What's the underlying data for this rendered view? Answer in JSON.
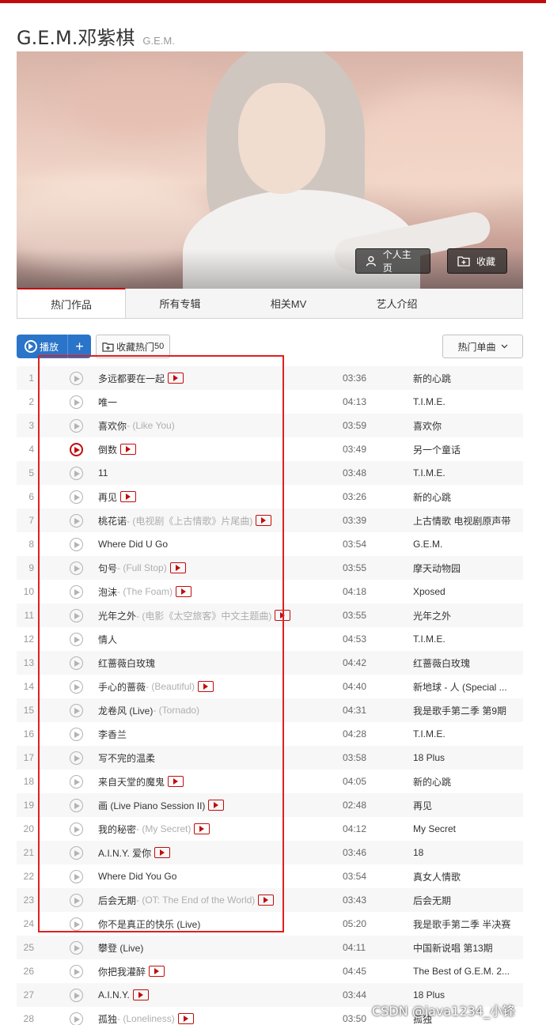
{
  "artist": {
    "name": "G.E.M.邓紫棋",
    "alias": "G.E.M."
  },
  "banner": {
    "home_label": "个人主页",
    "collect_label": "收藏"
  },
  "tabs": [
    {
      "label": "热门作品",
      "active": true
    },
    {
      "label": "所有专辑",
      "active": false
    },
    {
      "label": "相关MV",
      "active": false
    },
    {
      "label": "艺人介绍",
      "active": false
    }
  ],
  "actions": {
    "play_label": "播放",
    "add_label": "+",
    "fav_label": "收藏热门",
    "fav_count": "50",
    "hot_label": "热门单曲"
  },
  "songs": [
    {
      "index": "1",
      "title": "多远都要在一起",
      "alias": "",
      "mv": true,
      "duration": "03:36",
      "album": "新的心跳",
      "playing": false
    },
    {
      "index": "2",
      "title": "唯一",
      "alias": "",
      "mv": false,
      "duration": "04:13",
      "album": "T.I.M.E.",
      "playing": false
    },
    {
      "index": "3",
      "title": "喜欢你",
      "alias": " - (Like You)",
      "mv": false,
      "duration": "03:59",
      "album": "喜欢你",
      "playing": false
    },
    {
      "index": "4",
      "title": "倒数",
      "alias": "",
      "mv": true,
      "duration": "03:49",
      "album": "另一个童话",
      "playing": true
    },
    {
      "index": "5",
      "title": "11",
      "alias": "",
      "mv": false,
      "duration": "03:48",
      "album": "T.I.M.E.",
      "playing": false
    },
    {
      "index": "6",
      "title": "再见",
      "alias": "",
      "mv": true,
      "duration": "03:26",
      "album": "新的心跳",
      "playing": false
    },
    {
      "index": "7",
      "title": "桃花诺",
      "alias": " - (电视剧《上古情歌》片尾曲)",
      "mv": true,
      "duration": "03:39",
      "album": "上古情歌 电视剧原声带",
      "playing": false
    },
    {
      "index": "8",
      "title": "Where Did U Go",
      "alias": "",
      "mv": false,
      "duration": "03:54",
      "album": "G.E.M.",
      "playing": false
    },
    {
      "index": "9",
      "title": "句号",
      "alias": " - (Full Stop)",
      "mv": true,
      "duration": "03:55",
      "album": "摩天动物园",
      "playing": false
    },
    {
      "index": "10",
      "title": "泡沫",
      "alias": " - (The Foam)",
      "mv": true,
      "duration": "04:18",
      "album": "Xposed",
      "playing": false
    },
    {
      "index": "11",
      "title": "光年之外",
      "alias": " - (电影《太空旅客》中文主题曲)",
      "mv": true,
      "duration": "03:55",
      "album": "光年之外",
      "playing": false
    },
    {
      "index": "12",
      "title": "情人",
      "alias": "",
      "mv": false,
      "duration": "04:53",
      "album": "T.I.M.E.",
      "playing": false
    },
    {
      "index": "13",
      "title": "红蔷薇白玫瑰",
      "alias": "",
      "mv": false,
      "duration": "04:42",
      "album": "红蔷薇白玫瑰",
      "playing": false
    },
    {
      "index": "14",
      "title": "手心的蔷薇",
      "alias": " - (Beautiful)",
      "mv": true,
      "duration": "04:40",
      "album": "新地球 - 人 (Special ...",
      "playing": false
    },
    {
      "index": "15",
      "title": "龙卷风 (Live)",
      "alias": " - (Tornado)",
      "mv": false,
      "duration": "04:31",
      "album": "我是歌手第二季 第9期",
      "playing": false
    },
    {
      "index": "16",
      "title": "李香兰",
      "alias": "",
      "mv": false,
      "duration": "04:28",
      "album": "T.I.M.E.",
      "playing": false
    },
    {
      "index": "17",
      "title": "写不完的温柔",
      "alias": "",
      "mv": false,
      "duration": "03:58",
      "album": "18 Plus",
      "playing": false
    },
    {
      "index": "18",
      "title": "来自天堂的魔鬼",
      "alias": "",
      "mv": true,
      "duration": "04:05",
      "album": "新的心跳",
      "playing": false
    },
    {
      "index": "19",
      "title": "画 (Live Piano Session II)",
      "alias": "",
      "mv": true,
      "duration": "02:48",
      "album": "再见",
      "playing": false
    },
    {
      "index": "20",
      "title": "我的秘密",
      "alias": " - (My Secret)",
      "mv": true,
      "duration": "04:12",
      "album": "My Secret",
      "playing": false
    },
    {
      "index": "21",
      "title": "A.I.N.Y. 爱你",
      "alias": "",
      "mv": true,
      "duration": "03:46",
      "album": "18",
      "playing": false
    },
    {
      "index": "22",
      "title": "Where Did You Go",
      "alias": "",
      "mv": false,
      "duration": "03:54",
      "album": "真女人情歌",
      "playing": false
    },
    {
      "index": "23",
      "title": "后会无期",
      "alias": " - (OT: The End of the World)",
      "mv": true,
      "duration": "03:43",
      "album": "后会无期",
      "playing": false
    },
    {
      "index": "24",
      "title": "你不是真正的快乐 (Live)",
      "alias": "",
      "mv": false,
      "duration": "05:20",
      "album": "我是歌手第二季 半决赛",
      "playing": false
    },
    {
      "index": "25",
      "title": "攀登 (Live)",
      "alias": "",
      "mv": false,
      "duration": "04:11",
      "album": "中国新说唱 第13期",
      "playing": false
    },
    {
      "index": "26",
      "title": "你把我灌醉",
      "alias": "",
      "mv": true,
      "duration": "04:45",
      "album": "The Best of G.E.M. 2...",
      "playing": false
    },
    {
      "index": "27",
      "title": "A.I.N.Y.",
      "alias": "",
      "mv": true,
      "duration": "03:44",
      "album": "18 Plus",
      "playing": false
    },
    {
      "index": "28",
      "title": "孤独",
      "alias": " - (Loneliness)",
      "mv": true,
      "duration": "03:50",
      "album": "孤独",
      "playing": false
    }
  ],
  "watermark": "CSDN @java1234_小锋",
  "colors": {
    "accent": "#c20c0c",
    "play_button": "#2a74c9",
    "highlight_box": "#e02020"
  }
}
